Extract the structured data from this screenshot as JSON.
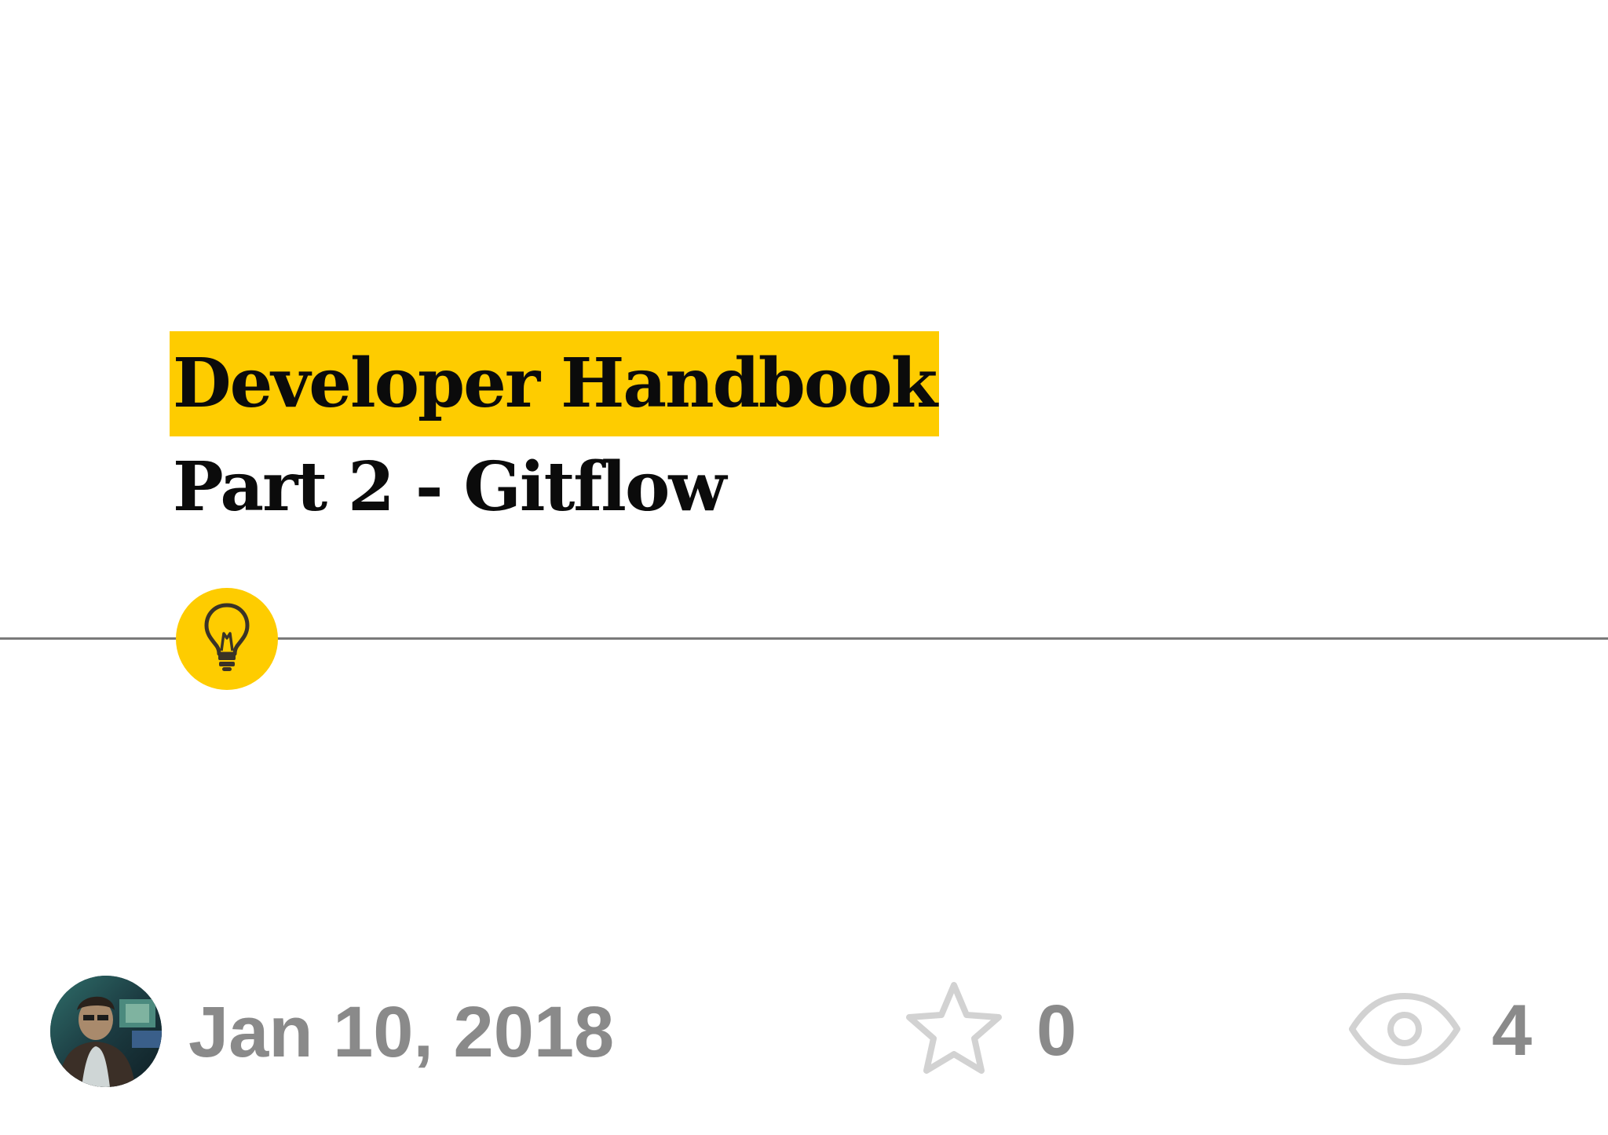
{
  "post": {
    "title": "Developer Handbook",
    "subtitle": "Part 2 - Gitflow",
    "category_icon": "lightbulb-icon"
  },
  "meta": {
    "date": "Jan 10, 2018",
    "star_count": "0",
    "view_count": "4"
  },
  "colors": {
    "accent": "#fecc00",
    "meta_text": "#8a8a8a",
    "icon_gray": "#d0d0d0",
    "divider": "#7a7a7a"
  }
}
